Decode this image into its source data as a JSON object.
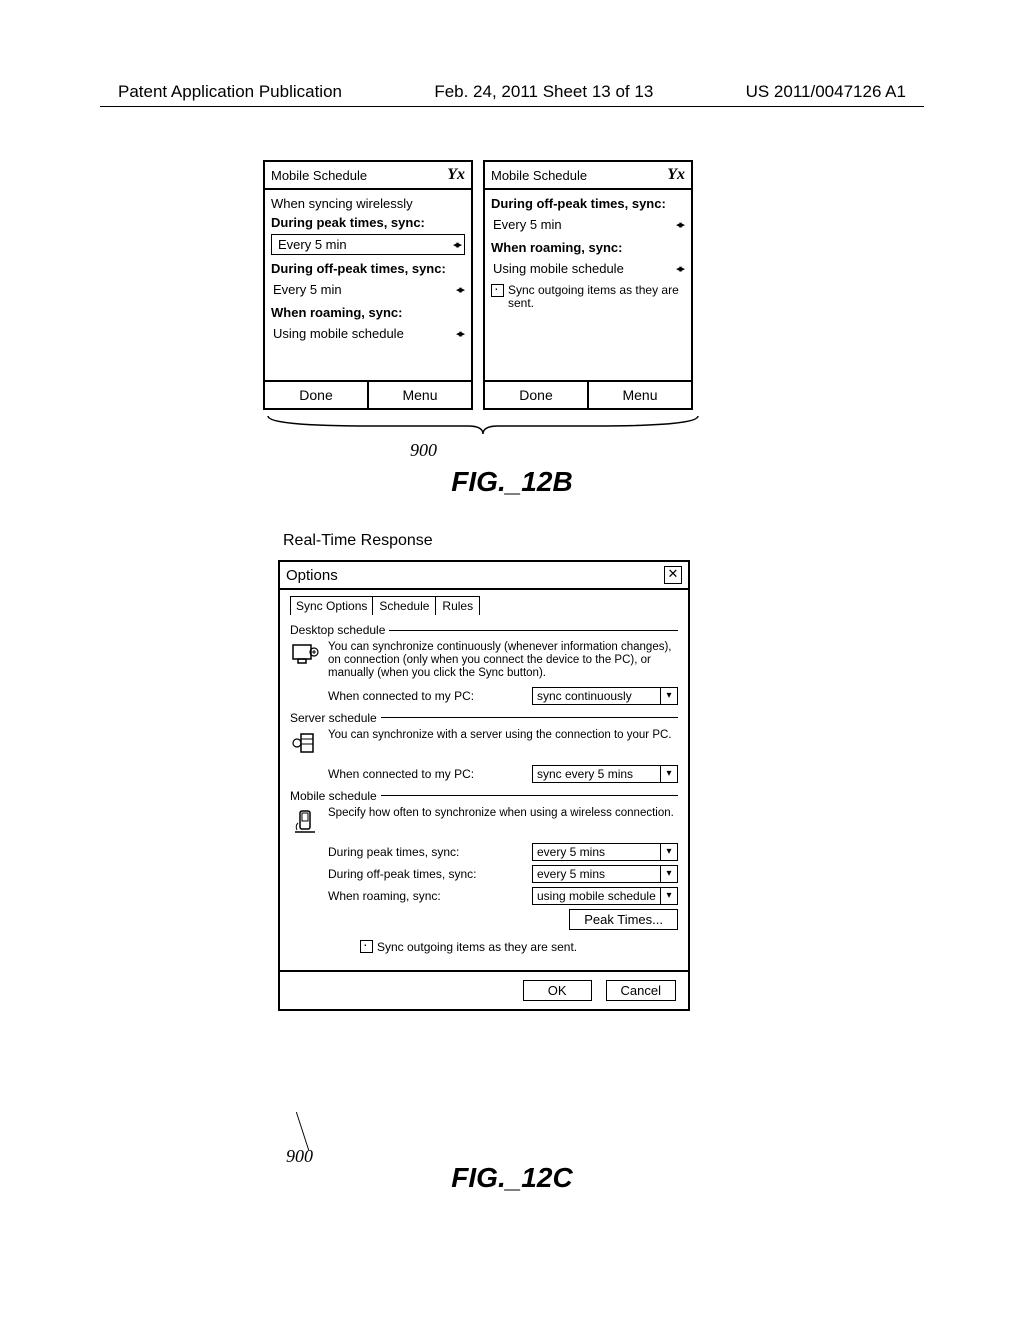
{
  "header": {
    "left": "Patent Application Publication",
    "center": "Feb. 24, 2011  Sheet 13 of 13",
    "right": "US 2011/0047126 A1"
  },
  "fig12b": {
    "ref": "900",
    "label": "FIG._12B",
    "left": {
      "title": "Mobile Schedule",
      "corner": "Yx",
      "line1": "When syncing wirelessly",
      "h1": "During peak times, sync:",
      "spinner1": "Every 5 min",
      "h2": "During off-peak times, sync:",
      "spinner2": "Every 5 min",
      "h3": "When roaming, sync:",
      "spinner3": "Using mobile schedule",
      "done": "Done",
      "menu": "Menu"
    },
    "right": {
      "title": "Mobile Schedule",
      "corner": "Yx",
      "h1": "During off-peak times, sync:",
      "spinner1": "Every 5 min",
      "h2": "When roaming, sync:",
      "spinner2": "Using mobile schedule",
      "checkbox": "Sync outgoing items as they are sent.",
      "done": "Done",
      "menu": "Menu"
    }
  },
  "fig12c": {
    "caption": "Real-Time Response",
    "ref": "900",
    "label": "FIG._12C",
    "dialog": {
      "title": "Options",
      "tabs": [
        "Sync Options",
        "Schedule",
        "Rules"
      ],
      "desktop": {
        "label": "Desktop schedule",
        "text": "You can synchronize continuously (whenever information changes), on connection (only when you connect the device to the PC), or manually (when you click the Sync button).",
        "row_label": "When connected to my PC:",
        "row_value": "sync continuously"
      },
      "server": {
        "label": "Server schedule",
        "text": "You can synchronize with a server using the connection to your PC.",
        "row_label": "When connected to my PC:",
        "row_value": "sync every 5 mins"
      },
      "mobile": {
        "label": "Mobile schedule",
        "text": "Specify how often to synchronize when using a wireless connection.",
        "row1_label": "During peak times, sync:",
        "row1_value": "every 5 mins",
        "row2_label": "During off-peak times, sync:",
        "row2_value": "every 5 mins",
        "row3_label": "When roaming, sync:",
        "row3_value": "using mobile schedule",
        "peak_button": "Peak Times...",
        "checkbox": "Sync outgoing items as they are sent."
      },
      "ok": "OK",
      "cancel": "Cancel"
    }
  }
}
